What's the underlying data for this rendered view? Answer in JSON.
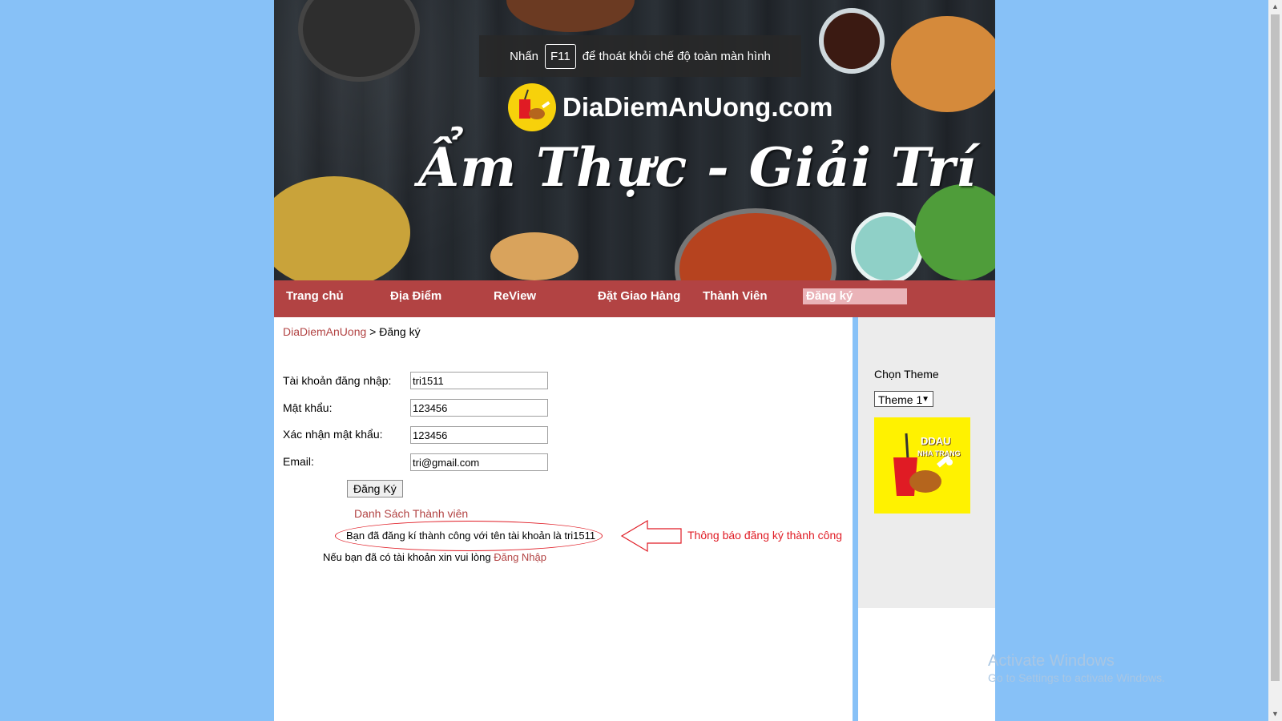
{
  "fullscreen_hint": {
    "prefix": "Nhấn",
    "key": "F11",
    "suffix": "để thoát khỏi chế độ toàn màn hình"
  },
  "banner": {
    "brand": "DiaDiemAnUong.com",
    "slogan": "Ẩm Thực - Giải Trí"
  },
  "nav": {
    "items": [
      {
        "label": "Trang chủ"
      },
      {
        "label": "Địa Điểm"
      },
      {
        "label": "ReView"
      },
      {
        "label": "Đặt Giao Hàng"
      },
      {
        "label": "Thành Viên"
      },
      {
        "label": "Đăng ký"
      }
    ]
  },
  "breadcrumb": {
    "home": "DiaDiemAnUong",
    "separator": ">",
    "current": "Đăng ký"
  },
  "form": {
    "username_label": "Tài khoản đăng nhập:",
    "username_value": "tri1511",
    "password_label": "Mật khẩu:",
    "password_value": "123456",
    "confirm_label": "Xác nhận mật khẩu:",
    "confirm_value": "123456",
    "email_label": "Email:",
    "email_value": "tri@gmail.com",
    "submit_label": "Đăng Ký"
  },
  "member_list_link": "Danh Sách Thành viên",
  "success_message": "Bạn đã đăng kí thành công với tên tài khoản là tri1511",
  "login_note": {
    "text": "Nếu bạn đã có tài khoản xin vui lòng",
    "link": "Đăng Nhập"
  },
  "annotation": {
    "text": "Thông báo đăng ký thành công",
    "color": "#e01b24"
  },
  "sidebar": {
    "theme_label": "Chọn Theme",
    "theme_selected": "Theme 1",
    "logo_line1": "DDAU",
    "logo_line2": "NHA TRANG"
  },
  "watermark": {
    "title": "Activate Windows",
    "subtitle": "Go to Settings to activate Windows."
  },
  "colors": {
    "background": "#87c1f7",
    "nav": "#b24343",
    "nav_active": "#eab3b8",
    "link": "#b24343",
    "sidebar": "#ececec"
  }
}
